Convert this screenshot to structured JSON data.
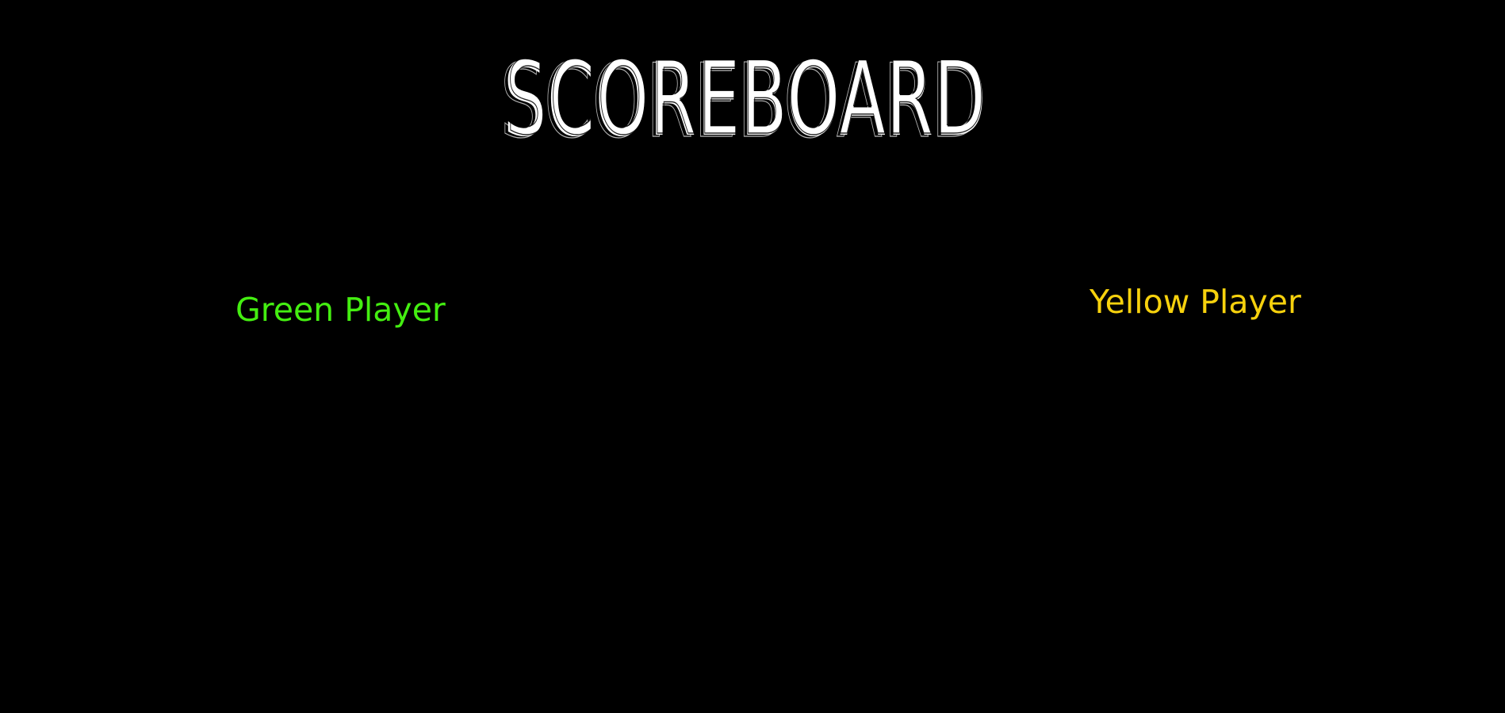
{
  "title": "SCOREBOARD",
  "players": [
    {
      "label": "Green Player",
      "color": "#44ee11"
    },
    {
      "label": "Yellow Player",
      "color": "#f6d10d"
    }
  ],
  "colors": {
    "background": "#000000",
    "title": "#ffffff"
  }
}
